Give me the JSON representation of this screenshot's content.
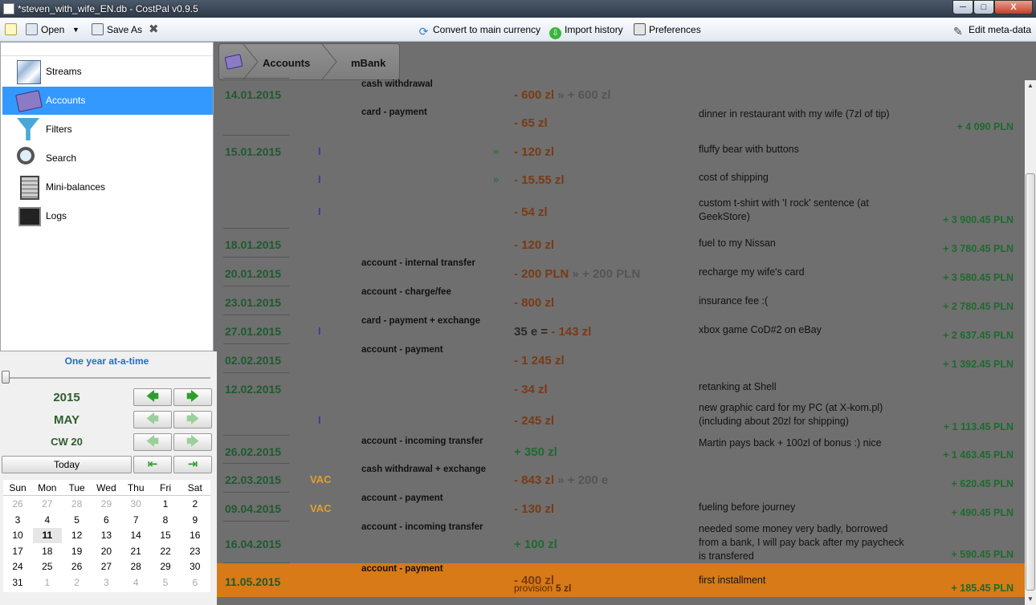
{
  "window": {
    "title": "*steven_with_wife_EN.db - CostPal v0.9.5",
    "close": "X"
  },
  "toolbar": {
    "new_icon": "new-doc-icon",
    "open": "Open",
    "save_as": "Save As",
    "convert": "Convert to main currency",
    "import_history": "Import history",
    "preferences": "Preferences",
    "edit_meta": "Edit meta-data"
  },
  "sidebar": {
    "items": [
      {
        "label": "Streams",
        "icon": "streams-icon"
      },
      {
        "label": "Accounts",
        "icon": "accounts-icon",
        "selected": true
      },
      {
        "label": "Filters",
        "icon": "funnel-icon"
      },
      {
        "label": "Search",
        "icon": "magnifier-icon"
      },
      {
        "label": "Mini-balances",
        "icon": "calculator-icon"
      },
      {
        "label": "Logs",
        "icon": "terminal-icon"
      }
    ]
  },
  "period": {
    "range_label": "One year at-a-time",
    "year": "2015",
    "month": "MAY",
    "week": "CW 20",
    "today": "Today"
  },
  "calendar": {
    "weekdays": [
      "Sun",
      "Mon",
      "Tue",
      "Wed",
      "Thu",
      "Fri",
      "Sat"
    ],
    "weeks": [
      [
        "26",
        "27",
        "28",
        "29",
        "30",
        "1",
        "2"
      ],
      [
        "3",
        "4",
        "5",
        "6",
        "7",
        "8",
        "9"
      ],
      [
        "10",
        "11",
        "12",
        "13",
        "14",
        "15",
        "16"
      ],
      [
        "17",
        "18",
        "19",
        "20",
        "21",
        "22",
        "23"
      ],
      [
        "24",
        "25",
        "26",
        "27",
        "28",
        "29",
        "30"
      ],
      [
        "31",
        "1",
        "2",
        "3",
        "4",
        "5",
        "6"
      ]
    ],
    "selected_day": "11"
  },
  "breadcrumb": {
    "level1": "Accounts",
    "level2": "mBank"
  },
  "transactions": [
    {
      "date": "14.01.2015",
      "flag": "",
      "cat": "cash withdrawal",
      "dbl": "",
      "amt": "- 600 zl",
      "amt2": " » + 600 zl",
      "note": "",
      "bal": ""
    },
    {
      "date": "",
      "flag": "",
      "cat": "card - payment",
      "dbl": "",
      "amt": "- 65 zl",
      "amt2": "",
      "note": "dinner in restaurant with my wife (7zl of tip)",
      "bal": "+ 4 090 PLN"
    },
    {
      "date": "15.01.2015",
      "flag": "I",
      "cat": "",
      "dbl": "»",
      "amt": "- 120 zl",
      "amt2": "",
      "note": "fluffy bear with buttons",
      "bal": ""
    },
    {
      "date": "",
      "flag": "I",
      "cat": "",
      "dbl": "»",
      "amt": "- 15.55 zl",
      "amt2": "",
      "note": "cost of shipping",
      "bal": ""
    },
    {
      "date": "",
      "flag": "I",
      "cat": "",
      "dbl": "",
      "amt": "- 54 zl",
      "amt2": "",
      "note": "custom t-shirt with 'I rock' sentence (at GeekStore)",
      "bal": "+ 3 900.45 PLN"
    },
    {
      "date": "18.01.2015",
      "flag": "",
      "cat": "",
      "dbl": "",
      "amt": "- 120 zl",
      "amt2": "",
      "note": "fuel to my Nissan",
      "bal": "+ 3 780.45 PLN"
    },
    {
      "date": "20.01.2015",
      "flag": "",
      "cat": "account - internal transfer",
      "dbl": "",
      "amt": "- 200 PLN",
      "amt2": " » + 200 PLN",
      "note": "recharge my wife's card",
      "bal": "+ 3 580.45 PLN"
    },
    {
      "date": "23.01.2015",
      "flag": "",
      "cat": "account - charge/fee",
      "dbl": "",
      "amt": "- 800 zl",
      "amt2": "",
      "note": "insurance fee :(",
      "bal": "+ 2 780.45 PLN"
    },
    {
      "date": "27.01.2015",
      "flag": "I",
      "cat": "card - payment + exchange",
      "dbl": "",
      "amt": "- 143 zl",
      "amt_pre": "35 e = ",
      "amt2": "",
      "note": "xbox game CoD#2 on eBay",
      "bal": "+ 2 637.45 PLN"
    },
    {
      "date": "02.02.2015",
      "flag": "",
      "cat": "account - payment",
      "dbl": "",
      "amt": "- 1 245 zl",
      "amt2": "",
      "note": "",
      "bal": "+ 1 392.45 PLN"
    },
    {
      "date": "12.02.2015",
      "flag": "",
      "cat": "",
      "dbl": "",
      "amt": "- 34 zl",
      "amt2": "",
      "note": "retanking at Shell",
      "bal": ""
    },
    {
      "date": "",
      "flag": "I",
      "cat": "",
      "dbl": "",
      "amt": "- 245 zl",
      "amt2": "",
      "note": "new graphic card for my PC (at X-kom.pl) (including about 20zl for shipping)",
      "bal": "+ 1 113.45 PLN"
    },
    {
      "date": "26.02.2015",
      "flag": "",
      "cat": "account - incoming transfer",
      "dbl": "",
      "amt": "+ 350 zl",
      "amt2": "",
      "note": "Martin pays back + 100zl of bonus :) nice",
      "bal": "+ 1 463.45 PLN"
    },
    {
      "date": "22.03.2015",
      "flag": "VAC",
      "cat": "cash withdrawal + exchange",
      "dbl": "",
      "amt": "- 843 zl",
      "amt2": " » + 200 e",
      "note": "",
      "bal": "+ 620.45 PLN"
    },
    {
      "date": "09.04.2015",
      "flag": "VAC",
      "cat": "account - payment",
      "dbl": "",
      "amt": "- 130 zl",
      "amt2": "",
      "note": "fueling before journey",
      "bal": "+ 490.45 PLN"
    },
    {
      "date": "16.04.2015",
      "flag": "",
      "cat": "account - incoming transfer",
      "dbl": "",
      "amt": "+ 100 zl",
      "amt2": "",
      "note": "needed some money very badly, borrowed from a bank, I will pay back after my paycheck is transfered",
      "bal": "+ 590.45 PLN"
    },
    {
      "date": "11.05.2015",
      "flag": "",
      "cat": "account - payment",
      "dbl": "",
      "amt": "- 400 zl",
      "amt2": "",
      "provision": "provision",
      "provision_val": "5 zl",
      "note": "first installment",
      "bal": "+ 185.45 PLN"
    }
  ]
}
